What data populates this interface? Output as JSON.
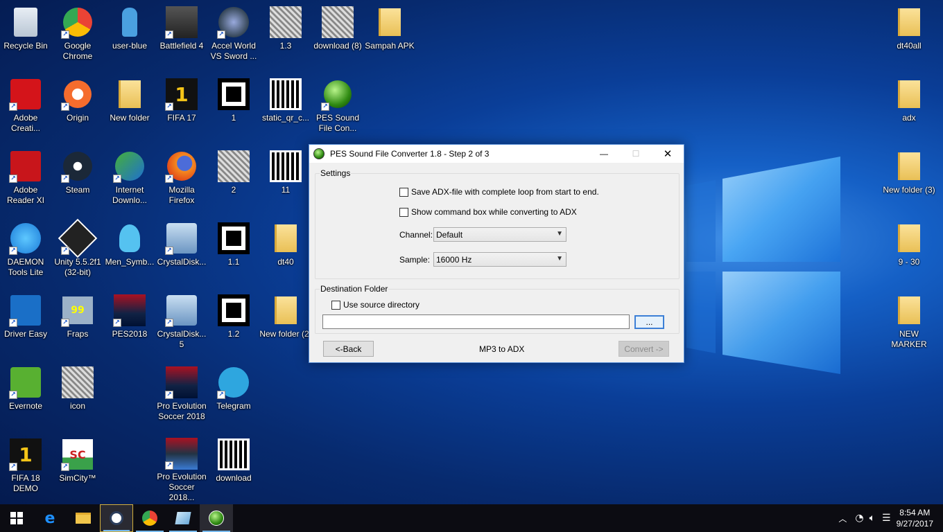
{
  "desktop": {
    "icons": [
      {
        "label": "Recycle Bin",
        "icon": "recycle-bin-icon"
      },
      {
        "label": "Google Chrome",
        "icon": "chrome-icon"
      },
      {
        "label": "user-blue",
        "icon": "user-icon"
      },
      {
        "label": "Battlefield 4",
        "icon": "battlefield-icon"
      },
      {
        "label": "Accel World VS Sword ...",
        "icon": "game-icon"
      },
      {
        "label": "1.3",
        "icon": "image-icon"
      },
      {
        "label": "download (8)",
        "icon": "image-icon"
      },
      {
        "label": "Sampah APK",
        "icon": "folder-icon"
      },
      {
        "label": "dt40all",
        "icon": "folder-icon"
      },
      {
        "label": "Adobe Creati...",
        "icon": "adobe-cc-icon"
      },
      {
        "label": "Origin",
        "icon": "origin-icon"
      },
      {
        "label": "New folder",
        "icon": "folder-icon"
      },
      {
        "label": "FIFA 17",
        "icon": "fifa-icon"
      },
      {
        "label": "1",
        "icon": "marker-icon"
      },
      {
        "label": "static_qr_c...",
        "icon": "qr-icon"
      },
      {
        "label": "PES Sound File Con...",
        "icon": "pes-sound-icon"
      },
      {
        "label": "adx",
        "icon": "folder-icon"
      },
      {
        "label": "Adobe Reader XI",
        "icon": "adobe-reader-icon"
      },
      {
        "label": "Steam",
        "icon": "steam-icon"
      },
      {
        "label": "Internet Downlo...",
        "icon": "idm-icon"
      },
      {
        "label": "Mozilla Firefox",
        "icon": "firefox-icon"
      },
      {
        "label": "2",
        "icon": "image-icon"
      },
      {
        "label": "11",
        "icon": "qr-icon"
      },
      {
        "label": "New folder (3)",
        "icon": "folder-icon"
      },
      {
        "label": "DAEMON Tools Lite",
        "icon": "daemon-icon"
      },
      {
        "label": "Unity 5.5.2f1 (32-bit)",
        "icon": "unity-icon"
      },
      {
        "label": "Men_Symb...",
        "icon": "symbol-icon"
      },
      {
        "label": "CrystalDisk...",
        "icon": "crystaldisk-icon"
      },
      {
        "label": "1.1",
        "icon": "marker-icon"
      },
      {
        "label": "dt40",
        "icon": "folder-icon"
      },
      {
        "label": "9 - 30",
        "icon": "folder-icon"
      },
      {
        "label": "Driver Easy",
        "icon": "drivereasy-icon"
      },
      {
        "label": "Fraps",
        "icon": "fraps-icon"
      },
      {
        "label": "PES2018",
        "icon": "pes-icon"
      },
      {
        "label": "CrystalDisk... 5",
        "icon": "crystaldisk-icon"
      },
      {
        "label": "1.2",
        "icon": "marker-icon"
      },
      {
        "label": "New folder (2)",
        "icon": "folder-icon"
      },
      {
        "label": "NEW MARKER",
        "icon": "folder-icon"
      },
      {
        "label": "Evernote",
        "icon": "evernote-icon"
      },
      {
        "label": "icon",
        "icon": "image-icon"
      },
      {
        "label": "Pro Evolution Soccer 2018",
        "icon": "pes-icon"
      },
      {
        "label": "Telegram",
        "icon": "telegram-icon"
      },
      {
        "label": "FIFA 18 DEMO",
        "icon": "fifa-icon"
      },
      {
        "label": "SimCity™",
        "icon": "simcity-icon"
      },
      {
        "label": "Pro Evolution Soccer 2018...",
        "icon": "pes-settings-icon"
      },
      {
        "label": "download",
        "icon": "qr-icon"
      }
    ]
  },
  "dialog": {
    "title": "PES Sound File Converter 1.8 - Step 2 of 3",
    "settings_label": "Settings",
    "opt_loop": "Save ADX-file with complete loop from start to end.",
    "opt_cmd": "Show command box while converting to ADX",
    "channel_label": "Channel:",
    "channel_value": "Default",
    "sample_label": "Sample:",
    "sample_value": "16000 Hz",
    "dest_label": "Destination Folder",
    "use_source": "Use source directory",
    "dest_path": "",
    "browse": "...",
    "back": "<-Back",
    "mode": "MP3 to ADX",
    "convert": "Convert ->",
    "close_glyph": "✕",
    "min_glyph": "—",
    "max_glyph": "☐"
  },
  "taskbar": {
    "time": "8:54 AM",
    "date": "9/27/2017"
  }
}
